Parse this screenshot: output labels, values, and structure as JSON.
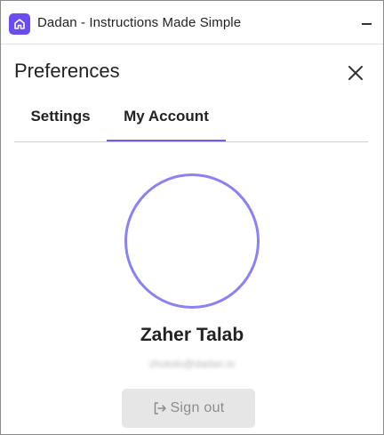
{
  "window": {
    "title": "Dadan - Instructions Made Simple"
  },
  "preferences": {
    "title": "Preferences",
    "tabs": [
      {
        "label": "Settings",
        "active": false
      },
      {
        "label": "My Account",
        "active": true
      }
    ]
  },
  "account": {
    "name": "Zaher Talab",
    "email": "zhotolo@dadan.io",
    "sign_out_label": "Sign out"
  },
  "icons": {
    "app": "dadan-logo-icon",
    "minimize": "minimize-icon",
    "close": "close-icon",
    "sign_out": "sign-out-icon"
  },
  "colors": {
    "accent": "#6b5cf0",
    "avatar_ring": "#8b80f5",
    "app_icon_bg": "#6b4cf0",
    "button_bg": "#e6e6e6",
    "button_text": "#8c8c8c"
  }
}
